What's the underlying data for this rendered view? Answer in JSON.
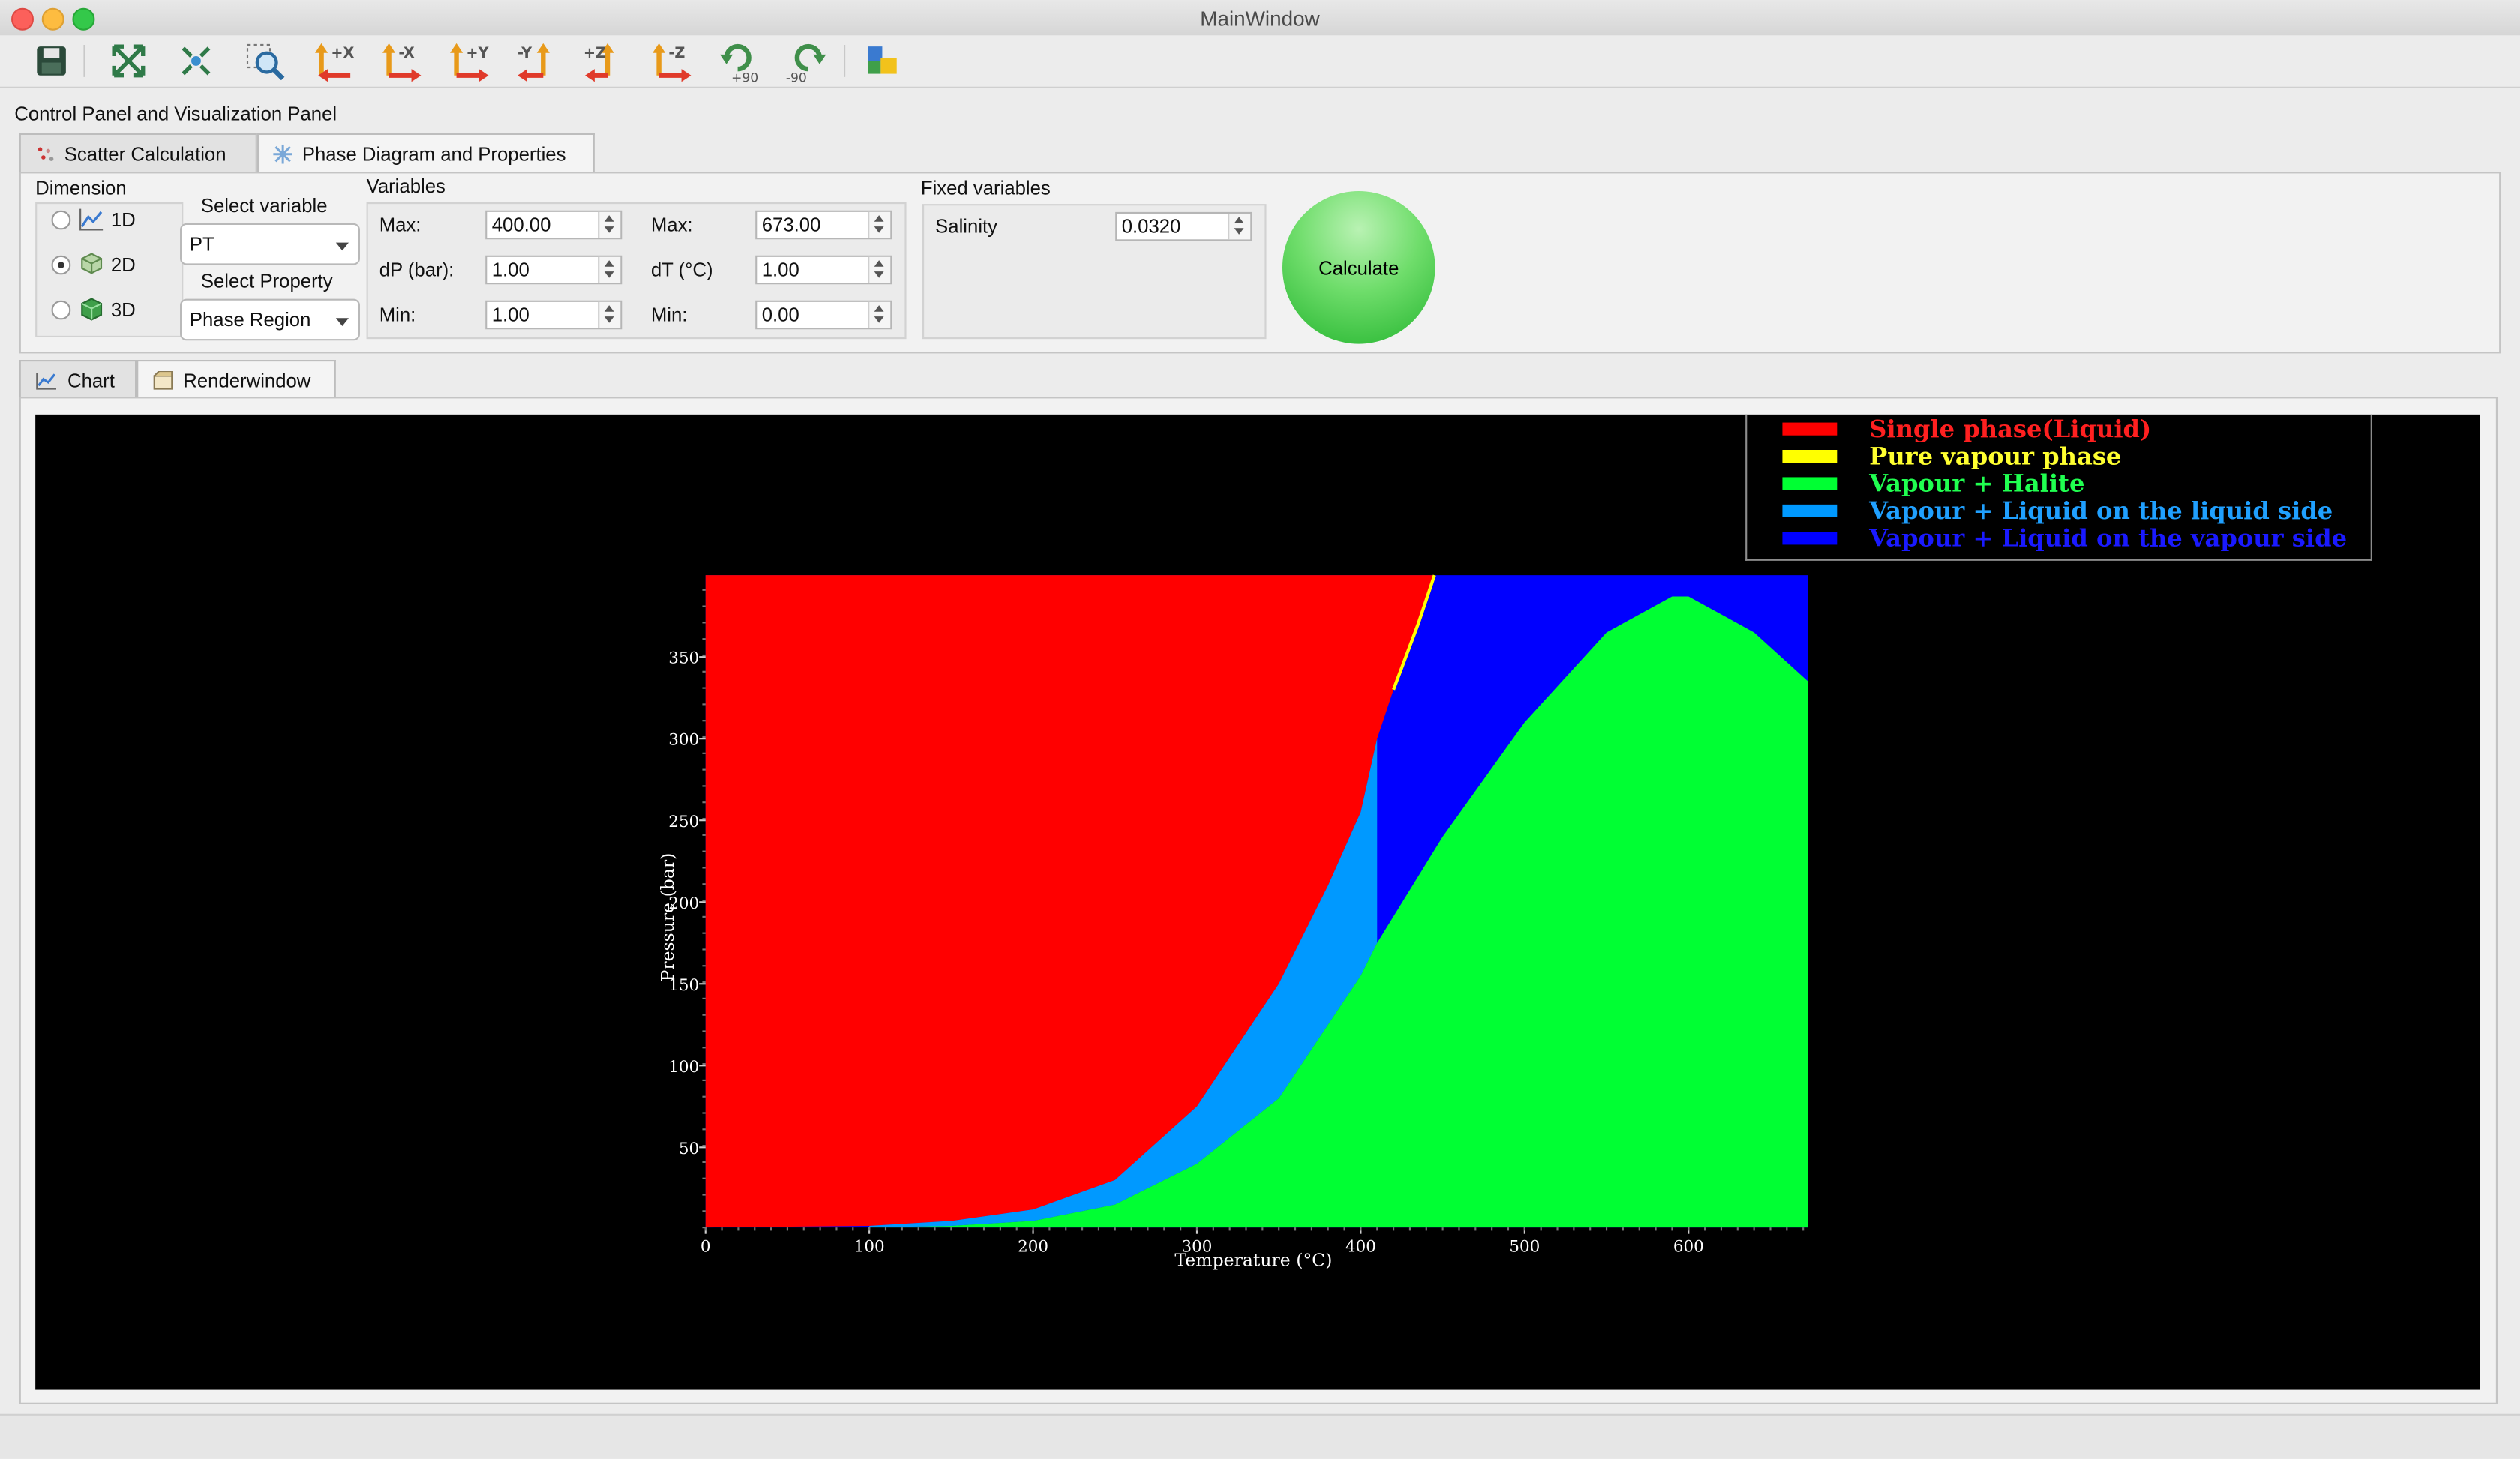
{
  "window": {
    "title": "MainWindow"
  },
  "toolbar": {
    "buttons": [
      {
        "name": "save-icon",
        "label": ""
      },
      {
        "name": "fit-view-icon",
        "label": ""
      },
      {
        "name": "scatter-view-icon",
        "label": ""
      },
      {
        "name": "zoom-region-icon",
        "label": ""
      },
      {
        "name": "view-plus-x-icon",
        "label": "+X"
      },
      {
        "name": "view-minus-x-icon",
        "label": "-X"
      },
      {
        "name": "view-plus-y-icon",
        "label": "+Y"
      },
      {
        "name": "view-minus-y-icon",
        "label": "-Y"
      },
      {
        "name": "view-plus-z-icon",
        "label": "+Z"
      },
      {
        "name": "view-minus-z-icon",
        "label": "-Z"
      },
      {
        "name": "rotate-plus-90-icon",
        "label": "+90"
      },
      {
        "name": "rotate-minus-90-icon",
        "label": "-90"
      },
      {
        "name": "layers-icon",
        "label": ""
      }
    ]
  },
  "panel_title": "Control Panel and Visualization Panel",
  "tabs": [
    {
      "label": "Scatter Calculation",
      "active": false
    },
    {
      "label": "Phase Diagram and Properties",
      "active": true
    }
  ],
  "dimension": {
    "title": "Dimension",
    "options": [
      {
        "label": "1D",
        "checked": false
      },
      {
        "label": "2D",
        "checked": true
      },
      {
        "label": "3D",
        "checked": false
      }
    ]
  },
  "select_variable": {
    "label": "Select variable",
    "value": "PT"
  },
  "select_property": {
    "label": "Select Property",
    "value": "Phase Region"
  },
  "variables": {
    "title": "Variables",
    "p_max": {
      "label": "Max:",
      "value": "400.00"
    },
    "dp": {
      "label": "dP (bar):",
      "value": "1.00"
    },
    "p_min": {
      "label": "Min:",
      "value": "1.00"
    },
    "t_max": {
      "label": "Max:",
      "value": "673.00"
    },
    "dt": {
      "label": "dT (°C)",
      "value": "1.00"
    },
    "t_min": {
      "label": "Min:",
      "value": "0.00"
    }
  },
  "fixed_variables": {
    "title": "Fixed variables",
    "salinity": {
      "label": "Salinity",
      "value": "0.0320"
    }
  },
  "calculate_label": "Calculate",
  "view_tabs": [
    {
      "label": "Chart",
      "active": false
    },
    {
      "label": "Renderwindow",
      "active": true
    }
  ],
  "chart_data": {
    "type": "area",
    "xlabel": "Temperature (°C)",
    "ylabel": "Pressure (bar)",
    "xlim": [
      0,
      673
    ],
    "ylim": [
      1,
      400
    ],
    "x_ticks": [
      0,
      100,
      200,
      300,
      400,
      500,
      600
    ],
    "y_ticks": [
      50,
      100,
      150,
      200,
      250,
      300,
      350
    ],
    "legend_position": "top-right",
    "series": [
      {
        "name": "Single phase(Liquid)",
        "color": "#ff0000"
      },
      {
        "name": "Pure vapour phase",
        "color": "#ffff00"
      },
      {
        "name": "Vapour + Halite",
        "color": "#00ff33"
      },
      {
        "name": "Vapour + Liquid on the liquid side",
        "color": "#0099ff"
      },
      {
        "name": "Vapour + Liquid on the vapour side",
        "color": "#0000ff"
      }
    ],
    "boundaries": {
      "liquid_upper": [
        [
          0,
          1
        ],
        [
          100,
          2
        ],
        [
          150,
          5
        ],
        [
          200,
          12
        ],
        [
          250,
          30
        ],
        [
          300,
          75
        ],
        [
          350,
          150
        ],
        [
          380,
          210
        ],
        [
          400,
          255
        ],
        [
          410,
          300
        ],
        [
          420,
          330
        ],
        [
          435,
          370
        ],
        [
          445,
          400
        ]
      ],
      "liquid_side_lower": [
        [
          100,
          1
        ],
        [
          150,
          3
        ],
        [
          200,
          8
        ],
        [
          250,
          25
        ],
        [
          300,
          60
        ],
        [
          350,
          120
        ],
        [
          380,
          165
        ],
        [
          400,
          190
        ],
        [
          410,
          200
        ]
      ],
      "halite_upper": [
        [
          100,
          1
        ],
        [
          150,
          2
        ],
        [
          200,
          5
        ],
        [
          250,
          15
        ],
        [
          300,
          40
        ],
        [
          350,
          80
        ],
        [
          400,
          155
        ],
        [
          410,
          175
        ],
        [
          450,
          240
        ],
        [
          500,
          310
        ],
        [
          550,
          365
        ],
        [
          590,
          387
        ],
        [
          600,
          387
        ],
        [
          640,
          365
        ],
        [
          673,
          335
        ]
      ],
      "vapour_side_boundary_T": 410
    }
  }
}
